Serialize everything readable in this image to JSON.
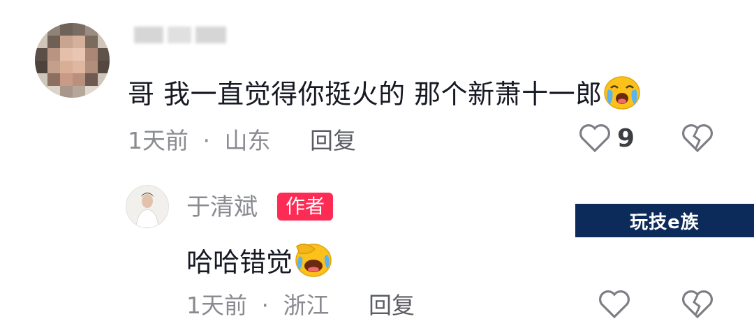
{
  "comment": {
    "text": "哥 我一直觉得你挺火的 那个新萧十一郎",
    "emoji_icon": "crying-face-icon",
    "time": "1天前",
    "separator": "·",
    "location": "山东",
    "reply_label": "回复",
    "like_count": "9"
  },
  "reply": {
    "author": "于清斌",
    "badge": "作者",
    "text": "哈哈错觉",
    "emoji_icon": "laughing-covering-face-icon",
    "time": "1天前",
    "separator": "·",
    "location": "浙江",
    "reply_label": "回复"
  },
  "watermark": {
    "text": "玩技e族"
  },
  "colors": {
    "badge": "#fe2c55",
    "meta": "#8a8b91",
    "watermark_bg": "#0c2a5a"
  }
}
